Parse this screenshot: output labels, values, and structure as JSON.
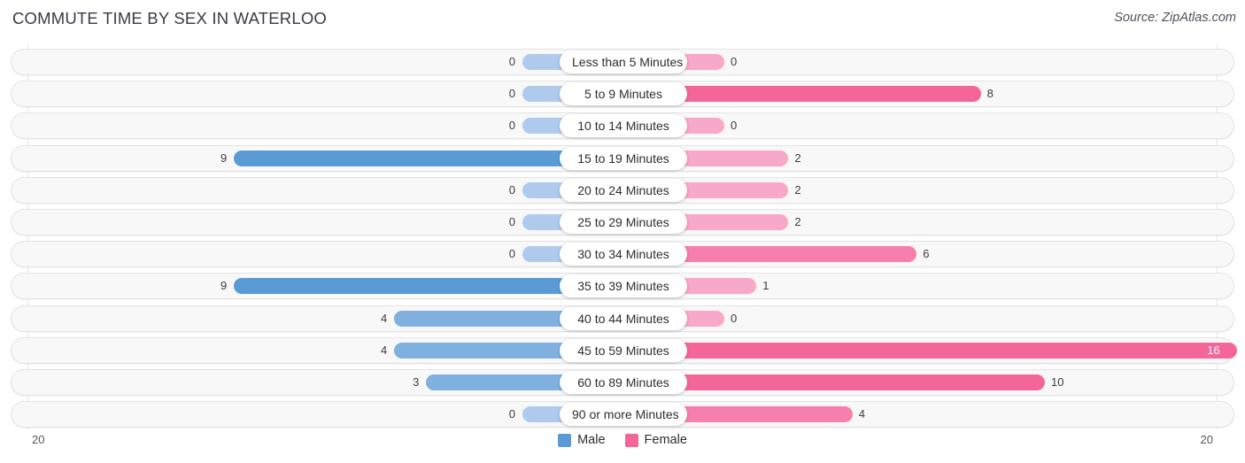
{
  "header": {
    "title": "COMMUTE TIME BY SEX IN WATERLOO",
    "source": "Source: ZipAtlas.com"
  },
  "legend": {
    "items": [
      {
        "label": "Male",
        "color": "#5b9bd5"
      },
      {
        "label": "Female",
        "color": "#f4669a"
      }
    ]
  },
  "axis": {
    "left_tick": "20",
    "right_tick": "20"
  },
  "colors": {
    "male_strong": "#5b9bd5",
    "male_mid": "#7fb0e0",
    "male_light": "#aecbee",
    "female_strong": "#f4669a",
    "female_mid": "#f77fae",
    "female_light": "#f8a8c8",
    "row_background": "#f8f8f8",
    "row_border": "#e3e3e3",
    "gridline": "#e4e4e4"
  },
  "chart_data": {
    "type": "bar",
    "title": "COMMUTE TIME BY SEX IN WATERLOO",
    "subtitle": "",
    "orientation": "horizontal-diverging",
    "xlabel": "",
    "ylabel": "",
    "xlim": [
      20,
      20
    ],
    "grid": true,
    "legend_position": "bottom-center",
    "categories": [
      "Less than 5 Minutes",
      "5 to 9 Minutes",
      "10 to 14 Minutes",
      "15 to 19 Minutes",
      "20 to 24 Minutes",
      "25 to 29 Minutes",
      "30 to 34 Minutes",
      "35 to 39 Minutes",
      "40 to 44 Minutes",
      "45 to 59 Minutes",
      "60 to 89 Minutes",
      "90 or more Minutes"
    ],
    "series": [
      {
        "name": "Male",
        "values": [
          0,
          0,
          0,
          9,
          0,
          0,
          0,
          9,
          4,
          4,
          3,
          0
        ]
      },
      {
        "name": "Female",
        "values": [
          0,
          8,
          0,
          2,
          2,
          2,
          6,
          1,
          0,
          16,
          10,
          4
        ]
      }
    ]
  },
  "rows": [
    {
      "category": "Less than 5 Minutes",
      "male": "0",
      "female": "0"
    },
    {
      "category": "5 to 9 Minutes",
      "male": "0",
      "female": "8"
    },
    {
      "category": "10 to 14 Minutes",
      "male": "0",
      "female": "0"
    },
    {
      "category": "15 to 19 Minutes",
      "male": "9",
      "female": "2"
    },
    {
      "category": "20 to 24 Minutes",
      "male": "0",
      "female": "2"
    },
    {
      "category": "25 to 29 Minutes",
      "male": "0",
      "female": "2"
    },
    {
      "category": "30 to 34 Minutes",
      "male": "0",
      "female": "6"
    },
    {
      "category": "35 to 39 Minutes",
      "male": "9",
      "female": "1"
    },
    {
      "category": "40 to 44 Minutes",
      "male": "4",
      "female": "0"
    },
    {
      "category": "45 to 59 Minutes",
      "male": "4",
      "female": "16"
    },
    {
      "category": "60 to 89 Minutes",
      "male": "3",
      "female": "10"
    },
    {
      "category": "90 or more Minutes",
      "male": "0",
      "female": "4"
    }
  ]
}
